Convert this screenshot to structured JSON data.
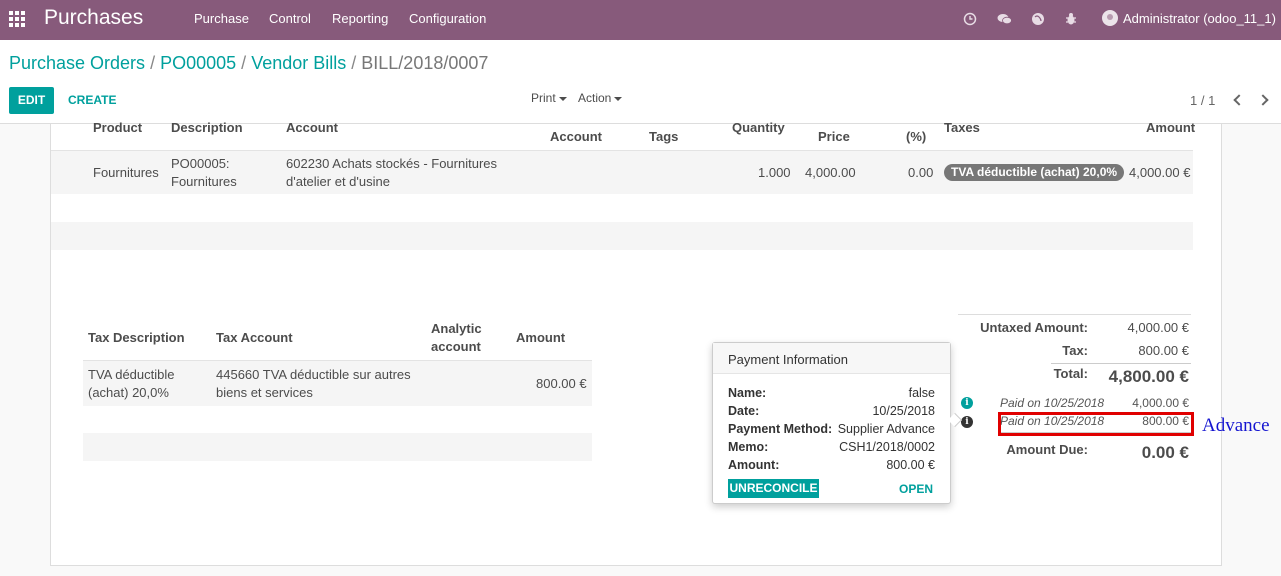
{
  "topbar": {
    "app_title": "Purchases",
    "menu": [
      "Purchase",
      "Control",
      "Reporting",
      "Configuration"
    ],
    "user": "Administrator (odoo_11_1)"
  },
  "breadcrumb": [
    "Purchase Orders",
    "PO00005",
    "Vendor Bills",
    "BILL/2018/0007"
  ],
  "buttons": {
    "edit": "EDIT",
    "create": "CREATE",
    "print": "Print",
    "action": "Action"
  },
  "pager": "1 / 1",
  "invoice_lines": {
    "headers": {
      "product": "Product",
      "description": "Description",
      "account": "Account",
      "analytic": "Account",
      "tags": "Tags",
      "quantity": "Quantity",
      "price": "Price",
      "discount": "(%)",
      "taxes": "Taxes",
      "amount": "Amount"
    },
    "row": {
      "product": "Fournitures",
      "description_1": "PO00005:",
      "description_2": "Fournitures",
      "account_1": "602230 Achats stockés - Fournitures",
      "account_2": "d'atelier et d'usine",
      "quantity": "1.000",
      "price": "4,000.00",
      "discount": "0.00",
      "tax_tag": "TVA déductible (achat) 20,0%",
      "amount": "4,000.00 €"
    }
  },
  "tax_table": {
    "headers": {
      "description": "Tax Description",
      "account": "Tax Account",
      "analytic_1": "Analytic",
      "analytic_2": "account",
      "amount": "Amount"
    },
    "row": {
      "description_1": "TVA déductible",
      "description_2": "(achat) 20,0%",
      "account_1": "445660 TVA déductible sur autres",
      "account_2": "biens et services",
      "amount": "800.00 €"
    }
  },
  "popover": {
    "title": "Payment Information",
    "fields": [
      {
        "label": "Name:",
        "value": "false"
      },
      {
        "label": "Date:",
        "value": "10/25/2018"
      },
      {
        "label": "Payment Method:",
        "value": "Supplier Advance"
      },
      {
        "label": "Memo:",
        "value": "CSH1/2018/0002"
      },
      {
        "label": "Amount:",
        "value": "800.00 €"
      }
    ],
    "unreconcile": "UNRECONCILE",
    "open": "OPEN"
  },
  "totals": {
    "untaxed_label": "Untaxed Amount:",
    "untaxed_value": "4,000.00 €",
    "tax_label": "Tax:",
    "tax_value": "800.00 €",
    "total_label": "Total:",
    "total_value": "4,800.00 €",
    "payments": [
      {
        "label": "Paid on 10/25/2018",
        "amount": "4,000.00 €"
      },
      {
        "label": "Paid on 10/25/2018",
        "amount": "800.00 €"
      }
    ],
    "due_label": "Amount Due:",
    "due_value": "0.00 €"
  },
  "annotation": "Advance",
  "colors": {
    "brand": "#875a7b",
    "accent": "#00a09d",
    "highlight": "#e00000",
    "annotation": "#1515d0"
  }
}
